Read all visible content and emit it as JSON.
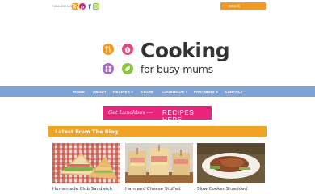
{
  "topbar": {
    "follow_label": "FOLLOW US",
    "social": [
      "rss-icon",
      "pinterest-icon",
      "facebook-icon",
      "instagram-icon"
    ],
    "search_placeholder": "Search"
  },
  "logo": {
    "word": "Cooking",
    "sub": "for busy mums"
  },
  "nav": {
    "items": [
      {
        "label": "HOME"
      },
      {
        "label": "ABOUT"
      },
      {
        "label": "RECIPES",
        "dropdown": true
      },
      {
        "label": "STORE"
      },
      {
        "label": "COOKBOOK",
        "dropdown": true
      },
      {
        "label": "PARTNERS",
        "dropdown": true
      },
      {
        "label": "CONTACT"
      }
    ]
  },
  "banner": {
    "script": "Get Lunchbox",
    "small": "ideas",
    "cta": "RECIPES HERE"
  },
  "latest": {
    "title": "Latest From The Blog",
    "posts": [
      {
        "title": "Homemade Club Sandwich"
      },
      {
        "title": "Ham and Cheese Stuffed"
      },
      {
        "title": "Slow Cooker Shredded"
      }
    ]
  },
  "colors": {
    "accent_orange": "#f4a223",
    "nav_blue": "#80a3d5",
    "banner_pink": "#e8257a",
    "logo_orange": "#f29a1f",
    "logo_pink": "#e4467d",
    "logo_purple": "#a56bc7",
    "logo_green": "#8cc63f"
  }
}
